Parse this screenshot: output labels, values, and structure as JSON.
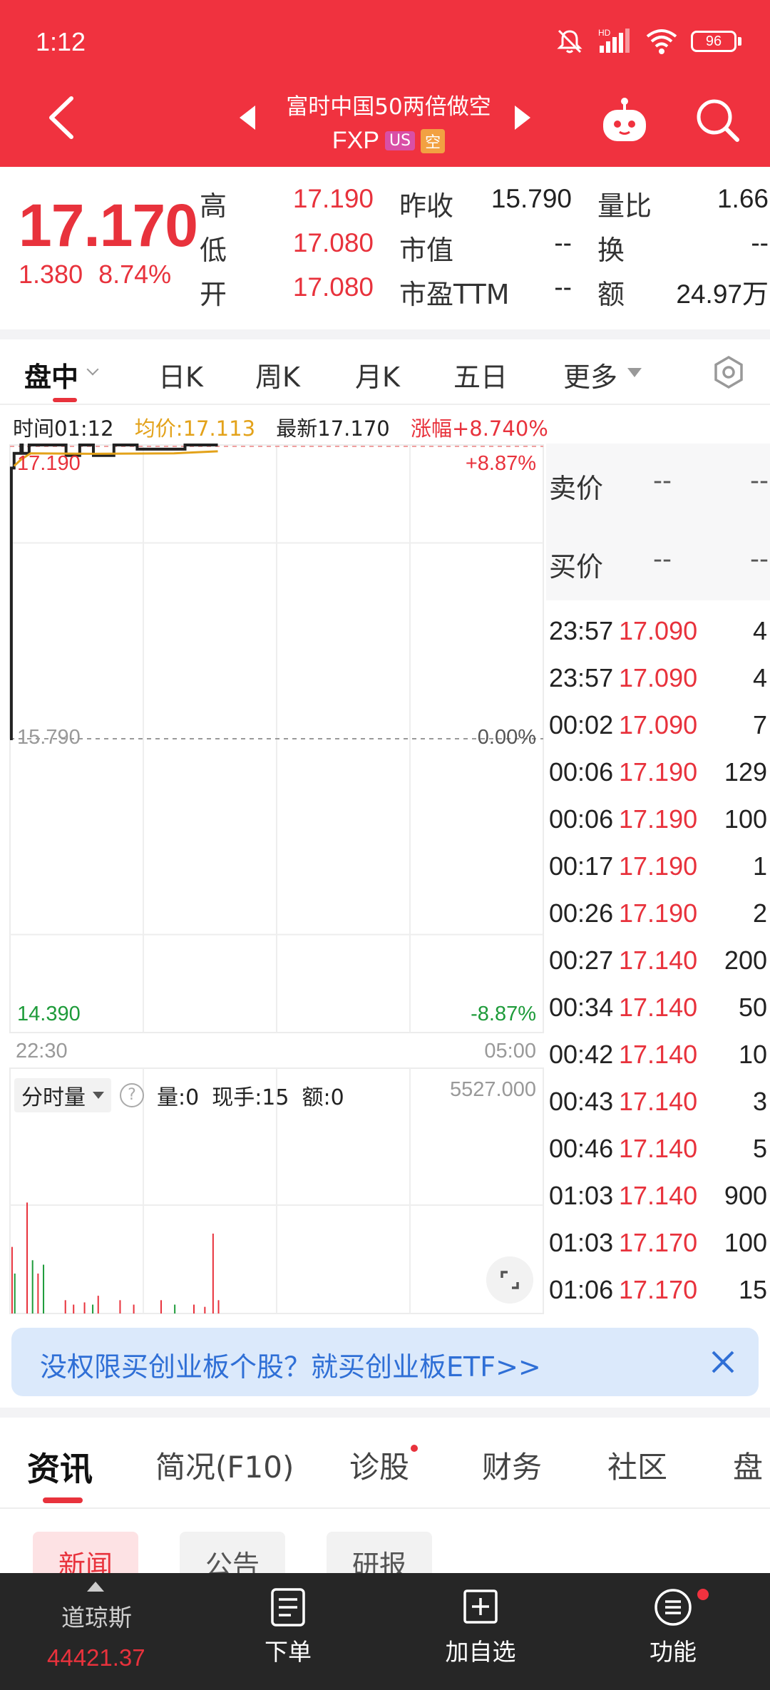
{
  "status_bar": {
    "time": "1:12",
    "battery": "96",
    "icons": [
      "mute-icon",
      "hd-signal-icon",
      "wifi-icon",
      "battery-icon"
    ]
  },
  "header": {
    "stock_name": "富时中国50两倍做空",
    "ticker": "FXP",
    "tags": [
      "US",
      "空"
    ],
    "colors": {
      "background": "#f0323f",
      "tag_us": "#d94fa6",
      "tag_short": "#f2a142"
    }
  },
  "quote": {
    "last_price": "17.170",
    "change": "1.380",
    "change_pct": "8.74%",
    "fields": [
      {
        "label": "高",
        "value": "17.190"
      },
      {
        "label": "低",
        "value": "17.080"
      },
      {
        "label": "开",
        "value": "17.080"
      },
      {
        "label": "昨收",
        "value": "15.790"
      },
      {
        "label": "市值",
        "value": "--"
      },
      {
        "label": "市盈TTM",
        "value": "--"
      },
      {
        "label": "量比",
        "value": "1.66"
      },
      {
        "label": "换",
        "value": "--"
      },
      {
        "label": "额",
        "value": "24.97万"
      }
    ],
    "colors": {
      "up": "#e8323c"
    }
  },
  "period_tabs": [
    "盘中",
    "日K",
    "周K",
    "月K",
    "五日",
    "更多"
  ],
  "chart_info": {
    "time": "时间01:12",
    "avg": "均价:17.113",
    "latest": "最新17.170",
    "change": "涨幅+8.740%"
  },
  "chart_data": {
    "type": "line",
    "y_left_labels": {
      "top": "17.190",
      "mid": "15.790",
      "bottom": "14.390"
    },
    "y_right_labels": {
      "top": "+8.87%",
      "mid": "0.00%",
      "bottom": "-8.87%"
    },
    "x_labels": {
      "start": "22:30",
      "end": "05:00"
    },
    "ylim": [
      14.39,
      17.19
    ],
    "base_price": 15.79,
    "session_minutes": 390,
    "series": [
      {
        "points": [
          [
            0,
            15.79
          ],
          [
            1,
            17.08
          ],
          [
            3,
            17.15
          ],
          [
            8,
            17.19
          ],
          [
            9,
            17.15
          ],
          [
            14,
            17.19
          ],
          [
            40,
            17.19
          ],
          [
            41,
            17.14
          ],
          [
            50,
            17.14
          ],
          [
            51,
            17.19
          ],
          [
            60,
            17.19
          ],
          [
            61,
            17.14
          ],
          [
            75,
            17.14
          ],
          [
            76,
            17.19
          ],
          [
            92,
            17.19
          ],
          [
            93,
            17.17
          ],
          [
            127,
            17.17
          ],
          [
            128,
            17.19
          ],
          [
            152,
            17.19
          ]
        ]
      },
      {
        "points": [
          [
            3,
            17.09
          ],
          [
            8,
            17.12
          ],
          [
            15,
            17.15
          ],
          [
            60,
            17.148
          ],
          [
            120,
            17.15
          ],
          [
            152,
            17.16
          ]
        ]
      }
    ],
    "colors": {
      "price": "#222222",
      "avg": "#e3a21a"
    },
    "volume": {
      "max_label": "5527.000",
      "bars": [
        [
          1,
          1500,
          "up"
        ],
        [
          3,
          900,
          "down"
        ],
        [
          12,
          2500,
          "up"
        ],
        [
          16,
          1200,
          "down"
        ],
        [
          20,
          900,
          "up"
        ],
        [
          24,
          1100,
          "down"
        ],
        [
          40,
          300,
          "up"
        ],
        [
          46,
          200,
          "up"
        ],
        [
          54,
          250,
          "up"
        ],
        [
          60,
          200,
          "down"
        ],
        [
          64,
          400,
          "up"
        ],
        [
          80,
          300,
          "up"
        ],
        [
          90,
          200,
          "up"
        ],
        [
          110,
          300,
          "up"
        ],
        [
          120,
          200,
          "down"
        ],
        [
          134,
          200,
          "up"
        ],
        [
          142,
          150,
          "up"
        ],
        [
          148,
          1800,
          "up"
        ],
        [
          152,
          300,
          "up"
        ]
      ]
    }
  },
  "volume_toolbar": {
    "select": "分时量",
    "help": "?",
    "vol": "量:0",
    "hand": "现手:15",
    "amount": "额:0"
  },
  "order_book": {
    "ask": {
      "label": "卖价",
      "price": "--",
      "qty": "--"
    },
    "bid": {
      "label": "买价",
      "price": "--",
      "qty": "--"
    }
  },
  "trades": [
    {
      "time": "23:57",
      "price": "17.090",
      "qty": "4"
    },
    {
      "time": "23:57",
      "price": "17.090",
      "qty": "4"
    },
    {
      "time": "00:02",
      "price": "17.090",
      "qty": "7"
    },
    {
      "time": "00:06",
      "price": "17.190",
      "qty": "129"
    },
    {
      "time": "00:06",
      "price": "17.190",
      "qty": "100"
    },
    {
      "time": "00:17",
      "price": "17.190",
      "qty": "1"
    },
    {
      "time": "00:26",
      "price": "17.190",
      "qty": "2"
    },
    {
      "time": "00:27",
      "price": "17.140",
      "qty": "200"
    },
    {
      "time": "00:34",
      "price": "17.140",
      "qty": "50"
    },
    {
      "time": "00:42",
      "price": "17.140",
      "qty": "10"
    },
    {
      "time": "00:43",
      "price": "17.140",
      "qty": "3"
    },
    {
      "time": "00:46",
      "price": "17.140",
      "qty": "5"
    },
    {
      "time": "01:03",
      "price": "17.140",
      "qty": "900"
    },
    {
      "time": "01:03",
      "price": "17.170",
      "qty": "100"
    },
    {
      "time": "01:06",
      "price": "17.170",
      "qty": "15"
    }
  ],
  "banner": {
    "text": "没权限买创业板个股？就买创业板ETF>>"
  },
  "info_tabs": [
    "资讯",
    "简况(F10)",
    "诊股",
    "财务",
    "社区",
    "盘"
  ],
  "sub_tabs": [
    "新闻",
    "公告",
    "研报"
  ],
  "bottom_nav": {
    "index_name": "道琼斯",
    "index_value": "44421.37",
    "items": [
      "下单",
      "加自选",
      "功能"
    ]
  }
}
